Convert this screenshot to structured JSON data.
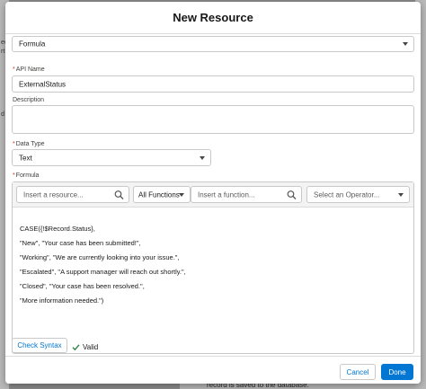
{
  "modal": {
    "title": "New Resource"
  },
  "resource_type": {
    "value": "Formula"
  },
  "api_name": {
    "label": "API Name",
    "value": "ExternalStatus"
  },
  "description": {
    "label": "Description",
    "value": ""
  },
  "data_type": {
    "label": "Data Type",
    "value": "Text"
  },
  "formula": {
    "label": "Formula",
    "resource_search_placeholder": "Insert a resource...",
    "functions_filter_value": "All Functions",
    "function_search_placeholder": "Insert a function...",
    "operator_placeholder": "Select an Operator...",
    "lines": [
      "CASE({!$Record.Status},",
      "\"New\", \"Your case has been submitted!\",",
      "\"Working\", \"We are currently looking into your issue.\",",
      "\"Escalated\", \"A support manager will reach out shortly.\",",
      "\"Closed\", \"Your case has been resolved.\",",
      "\"More information needed.\")"
    ]
  },
  "footer": {
    "check_syntax_label": "Check Syntax",
    "valid_label": "Valid",
    "cancel_label": "Cancel",
    "done_label": "Done"
  },
  "background": {
    "fragment_top": "ec",
    "fragment_top2": "rt",
    "fragment_mid": "d",
    "fragment_bottom": "record is saved to the database."
  },
  "colors": {
    "brand": "#0176d3",
    "required": "#c23934",
    "valid_check": "#2e844a"
  }
}
